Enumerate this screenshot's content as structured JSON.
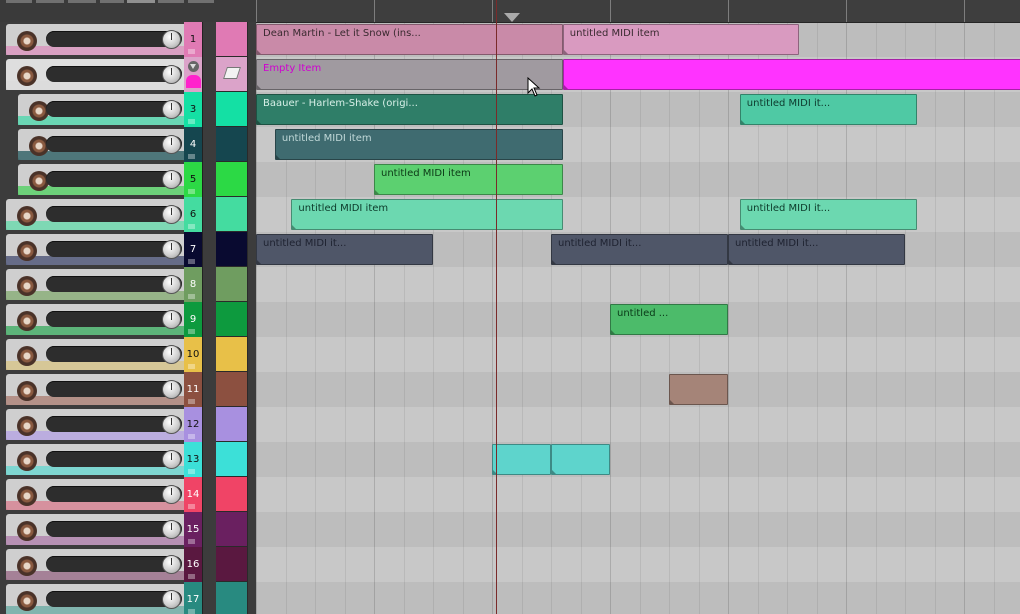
{
  "window": {
    "title": "REAPER arrange view"
  },
  "colors": {
    "background": "#3a3a3a",
    "lane_dark": "#bdbdbd",
    "lane_light": "#c8c8c8",
    "playhead": "#7a2a2a"
  },
  "tracks": [
    {
      "number": "1",
      "color": "#e07ab4",
      "panel": "#d99ac0",
      "kind": "normal"
    },
    {
      "number": "",
      "color": "#dba3c9",
      "panel": "#dcdcdc",
      "kind": "folder",
      "icon": "folder-collapse-icon"
    },
    {
      "number": "3",
      "color": "#14e0a4",
      "panel": "#5ed6b0",
      "kind": "child"
    },
    {
      "number": "4",
      "color": "#15464f",
      "panel": "#3f6b70",
      "kind": "child"
    },
    {
      "number": "5",
      "color": "#2cd945",
      "panel": "#62d070",
      "kind": "child"
    },
    {
      "number": "6",
      "color": "#44dca0",
      "panel": "#74d8b0",
      "kind": "normal"
    },
    {
      "number": "7",
      "color": "#090a30",
      "panel": "#5a6080",
      "kind": "normal"
    },
    {
      "number": "8",
      "color": "#6f9d60",
      "panel": "#8fb080",
      "kind": "normal"
    },
    {
      "number": "9",
      "color": "#0d9a3e",
      "panel": "#50b070",
      "kind": "normal"
    },
    {
      "number": "10",
      "color": "#e8c048",
      "panel": "#d6c590",
      "kind": "normal"
    },
    {
      "number": "11",
      "color": "#8c5040",
      "panel": "#b08a80",
      "kind": "normal"
    },
    {
      "number": "12",
      "color": "#a890e0",
      "panel": "#b8a8e0",
      "kind": "normal"
    },
    {
      "number": "13",
      "color": "#3ce0d8",
      "panel": "#74d6d0",
      "kind": "normal"
    },
    {
      "number": "14",
      "color": "#f04466",
      "panel": "#d68a98",
      "kind": "normal"
    },
    {
      "number": "15",
      "color": "#6a2060",
      "panel": "#b48ab0",
      "kind": "normal"
    },
    {
      "number": "16",
      "color": "#5a1840",
      "panel": "#a07890",
      "kind": "normal"
    },
    {
      "number": "17",
      "color": "#288a80",
      "panel": "#78b0aa",
      "kind": "normal"
    }
  ],
  "items": [
    {
      "track": 0,
      "label": "Dean Martin - Let it Snow (ins...",
      "color": "#c98aa8",
      "text": "#3a2a30",
      "start_bar": 1.5,
      "end_bar": 2.8
    },
    {
      "track": 0,
      "label": "untitled MIDI item",
      "color": "#d99ac0",
      "text": "#3a2a30",
      "start_bar": 2.8,
      "end_bar": 3.8
    },
    {
      "track": 0,
      "label": "untitled MIDI item",
      "color": "#d99ac0",
      "text": "#3a2a30",
      "start_bar": 4.8,
      "end_bar": 5.8
    },
    {
      "track": 1,
      "label": "Empty Item",
      "color": "#a09aa0",
      "text": "#d000d0",
      "start_bar": 1.5,
      "end_bar": 2.8
    },
    {
      "track": 1,
      "label": "",
      "color": "#ff33ff",
      "text": "#ffffff",
      "start_bar": 2.8,
      "end_bar": 5.4
    },
    {
      "track": 2,
      "label": "Baauer - Harlem-Shake (origi...",
      "color": "#2f7e68",
      "text": "#d8f0e8",
      "start_bar": 1.5,
      "end_bar": 2.8
    },
    {
      "track": 2,
      "label": "untitled MIDI it...",
      "color": "#4fc9a4",
      "text": "#0e3a2e",
      "start_bar": 3.55,
      "end_bar": 4.3
    },
    {
      "track": 2,
      "label": "untitled MIDI it...",
      "color": "#4fc9a4",
      "text": "#0e3a2e",
      "start_bar": 5.55,
      "end_bar": 6.3
    },
    {
      "track": 3,
      "label": "untitled MIDI item",
      "color": "#3f6b70",
      "text": "#c0d8d8",
      "start_bar": 1.58,
      "end_bar": 2.8
    },
    {
      "track": 4,
      "label": "untitled MIDI item",
      "color": "#5cd070",
      "text": "#0c3a16",
      "start_bar": 2.0,
      "end_bar": 2.8
    },
    {
      "track": 5,
      "label": "untitled MIDI item",
      "color": "#6cd8b0",
      "text": "#0c3a2a",
      "start_bar": 1.65,
      "end_bar": 2.8
    },
    {
      "track": 5,
      "label": "untitled MIDI it...",
      "color": "#6cd8b0",
      "text": "#0c3a2a",
      "start_bar": 3.55,
      "end_bar": 4.3
    },
    {
      "track": 5,
      "label": "untitled MIDI it...",
      "color": "#6cd8b0",
      "text": "#0c3a2a",
      "start_bar": 5.55,
      "end_bar": 6.3
    },
    {
      "track": 6,
      "label": "untitled MIDI it...",
      "color": "#4f5668",
      "text": "#1e2230",
      "start_bar": 1.5,
      "end_bar": 2.25
    },
    {
      "track": 6,
      "label": "untitled MIDI it...",
      "color": "#4f5668",
      "text": "#1e2230",
      "start_bar": 2.75,
      "end_bar": 3.5
    },
    {
      "track": 6,
      "label": "untitled MIDI it...",
      "color": "#4f5668",
      "text": "#1e2230",
      "start_bar": 3.5,
      "end_bar": 4.25
    },
    {
      "track": 6,
      "label": "untitled MIDI it...",
      "color": "#4f5668",
      "text": "#1e2230",
      "start_bar": 4.75,
      "end_bar": 5.5
    },
    {
      "track": 8,
      "label": "untitled ...",
      "color": "#4cbb6a",
      "text": "#0a3a18",
      "start_bar": 3.0,
      "end_bar": 3.5
    },
    {
      "track": 8,
      "label": "untitled ...",
      "color": "#4cbb6a",
      "text": "#0a3a18",
      "start_bar": 5.0,
      "end_bar": 5.5
    },
    {
      "track": 10,
      "label": "",
      "color": "#a58478",
      "text": "#000000",
      "start_bar": 3.25,
      "end_bar": 3.5
    },
    {
      "track": 12,
      "label": "",
      "color": "#5ed4cc",
      "text": "#000000",
      "start_bar": 2.5,
      "end_bar": 2.75
    },
    {
      "track": 12,
      "label": "",
      "color": "#5ed4cc",
      "text": "#000000",
      "start_bar": 2.75,
      "end_bar": 3.0
    }
  ]
}
